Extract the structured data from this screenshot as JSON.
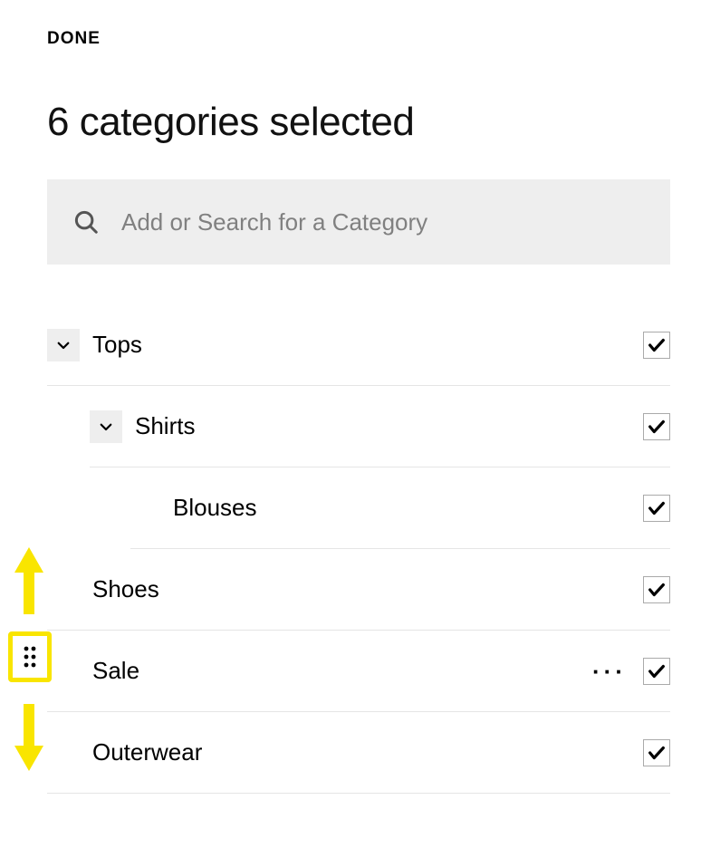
{
  "header": {
    "done_label": "DONE"
  },
  "page_title": "6 categories selected",
  "search": {
    "placeholder": "Add or Search for a Category",
    "value": ""
  },
  "categories": {
    "tops": {
      "label": "Tops"
    },
    "shirts": {
      "label": "Shirts"
    },
    "blouses": {
      "label": "Blouses"
    },
    "shoes": {
      "label": "Shoes"
    },
    "sale": {
      "label": "Sale"
    },
    "outerwear": {
      "label": "Outerwear"
    }
  },
  "icons": {
    "more": "···"
  }
}
